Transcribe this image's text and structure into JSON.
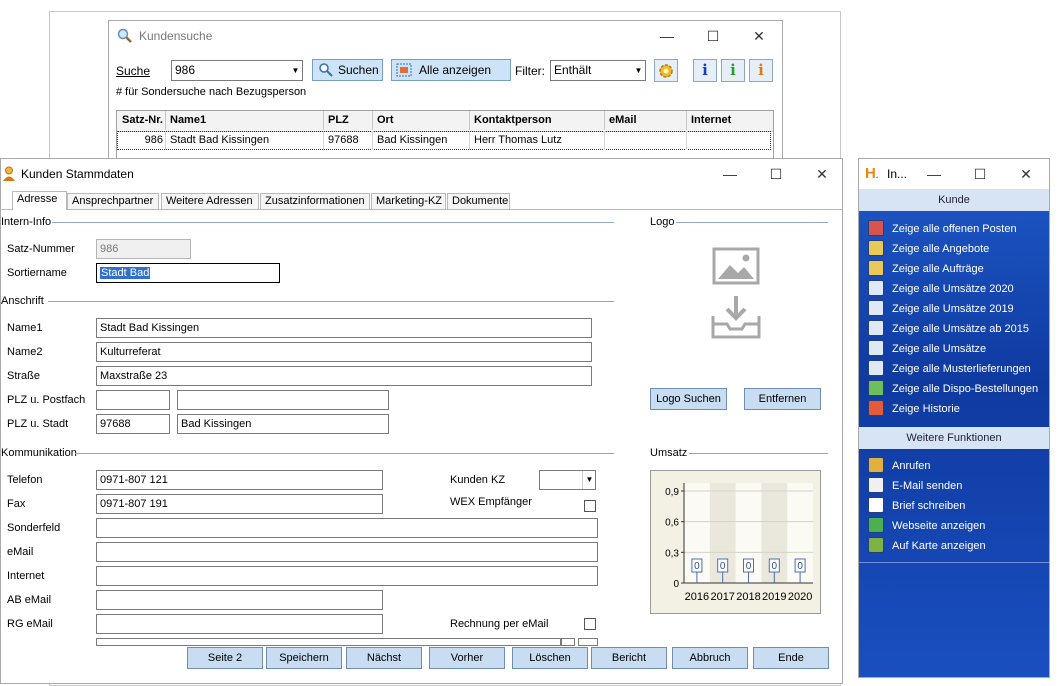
{
  "search_window": {
    "title": "Kundensuche",
    "search_label": "Suche",
    "search_value": "986",
    "search_button": "Suchen",
    "show_all_button": "Alle anzeigen",
    "filter_label": "Filter:",
    "filter_value": "Enthält",
    "hint": "# für Sondersuche nach Bezugsperson",
    "columns": [
      "Satz-Nr.",
      "Name1",
      "PLZ",
      "Ort",
      "Kontaktperson",
      "eMail",
      "Internet"
    ],
    "row": {
      "satz_nr": "986",
      "name1": "Stadt Bad Kissingen",
      "plz": "97688",
      "ort": "Bad Kissingen",
      "kontakt": "Herr Thomas Lutz",
      "email": "",
      "internet": ""
    }
  },
  "master_window": {
    "title": "Kunden Stammdaten",
    "tabs": [
      "Adresse",
      "Ansprechpartner",
      "Weitere Adressen",
      "Zusatzinformationen",
      "Marketing-KZ",
      "Dokumente"
    ],
    "sections": {
      "intern": "Intern-Info",
      "anschrift": "Anschrift",
      "kommunikation": "Kommunikation",
      "logo": "Logo",
      "umsatz": "Umsatz"
    },
    "labels": {
      "satz_nummer": "Satz-Nummer",
      "sortiername": "Sortiername",
      "name1": "Name1",
      "name2": "Name2",
      "strasse": "Straße",
      "plz_postfach": "PLZ u. Postfach",
      "plz_stadt": "PLZ u. Stadt",
      "telefon": "Telefon",
      "fax": "Fax",
      "sonderfeld": "Sonderfeld",
      "email": "eMail",
      "internet": "Internet",
      "ab_email": "AB eMail",
      "rg_email": "RG eMail",
      "kunden_kz": "Kunden KZ",
      "wex": "WEX Empfänger",
      "rechnung_email": "Rechnung per eMail"
    },
    "values": {
      "satz_nummer": "986",
      "sortiername": "Stadt Bad",
      "name1": "Stadt Bad Kissingen",
      "name2": "Kulturreferat",
      "strasse": "Maxstraße 23",
      "plz_postfach": "",
      "postfach": "",
      "plz": "97688",
      "stadt": "Bad Kissingen",
      "telefon": "0971-807 121",
      "fax": "0971-807 191",
      "sonderfeld": "",
      "email": "",
      "internet": "",
      "ab_email": "",
      "rg_email": "",
      "kunden_kz": ""
    },
    "logo_buttons": {
      "search": "Logo Suchen",
      "remove": "Entfernen"
    },
    "bottom_buttons": [
      "Seite 2",
      "Speichern",
      "Nächst",
      "Vorher",
      "Löschen",
      "Bericht",
      "Abbruch",
      "Ende"
    ]
  },
  "side_panel": {
    "title": "In...",
    "kunde_header": "Kunde",
    "kunde_items": [
      {
        "label": "Zeige alle offenen Posten",
        "icon": "open-items-icon",
        "color": "#d9534f"
      },
      {
        "label": "Zeige alle Angebote",
        "icon": "offers-icon",
        "color": "#e8c95a"
      },
      {
        "label": "Zeige alle Aufträge",
        "icon": "orders-icon",
        "color": "#e8c95a"
      },
      {
        "label": "Zeige alle Umsätze 2020",
        "icon": "sales-2020-icon",
        "color": "#dfe9f5"
      },
      {
        "label": "Zeige alle Umsätze 2019",
        "icon": "sales-2019-icon",
        "color": "#dfe9f5"
      },
      {
        "label": "Zeige alle Umsätze ab 2015",
        "icon": "sales-since-2015-icon",
        "color": "#dfe9f5"
      },
      {
        "label": "Zeige alle Umsätze",
        "icon": "all-sales-icon",
        "color": "#dfe9f5"
      },
      {
        "label": "Zeige alle Musterlieferungen",
        "icon": "sample-deliveries-icon",
        "color": "#dfe9f5"
      },
      {
        "label": "Zeige alle Dispo-Bestellungen",
        "icon": "dispo-orders-icon",
        "color": "#6cbf5a"
      },
      {
        "label": "Zeige Historie",
        "icon": "history-icon",
        "color": "#e55a3a"
      }
    ],
    "further_header": "Weitere Funktionen",
    "further_items": [
      {
        "label": "Anrufen",
        "icon": "phone-icon",
        "color": "#e0b040"
      },
      {
        "label": "E-Mail senden",
        "icon": "email-icon",
        "color": "#f0f0f0"
      },
      {
        "label": "Brief schreiben",
        "icon": "letter-icon",
        "color": "#ffffff"
      },
      {
        "label": "Webseite anzeigen",
        "icon": "web-icon",
        "color": "#4caf50"
      },
      {
        "label": "Auf Karte anzeigen",
        "icon": "map-icon",
        "color": "#7cb342"
      }
    ]
  },
  "chart_data": {
    "type": "bar",
    "categories": [
      "2016",
      "2017",
      "2018",
      "2019",
      "2020"
    ],
    "values": [
      0,
      0,
      0,
      0,
      0
    ],
    "data_labels": [
      "0",
      "0",
      "0",
      "0",
      "0"
    ],
    "y_ticks": [
      "0,9",
      "0,6",
      "0,3",
      "0"
    ],
    "ylim": [
      0,
      0.9
    ],
    "grid": true
  }
}
